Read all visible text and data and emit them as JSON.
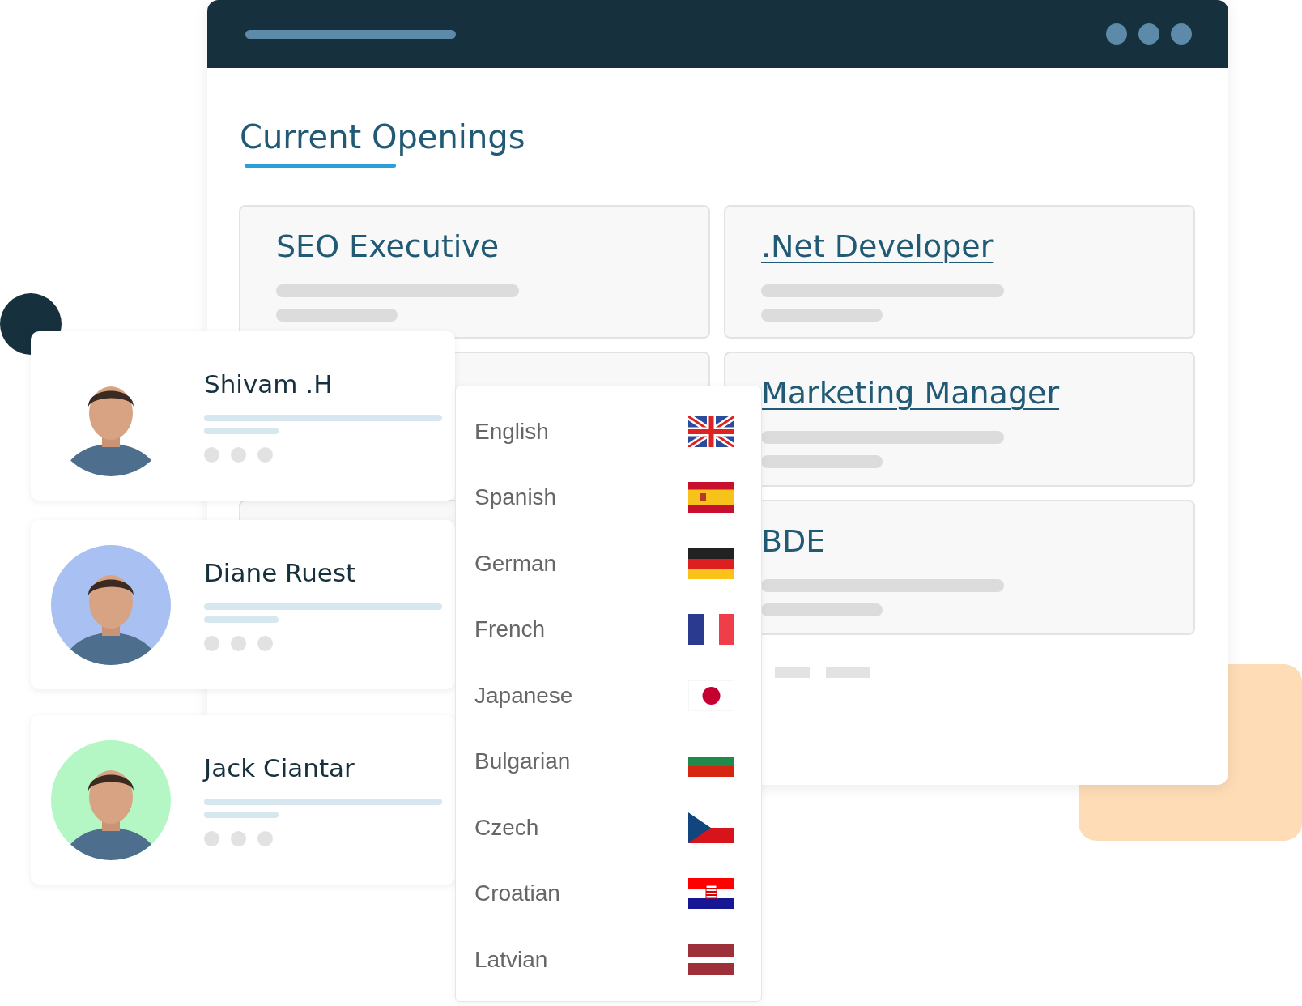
{
  "title": "Current Openings",
  "jobs": [
    {
      "title": "SEO Executive",
      "underlined": false
    },
    {
      "title": ".Net Developer",
      "underlined": true
    },
    {
      "title": "Marketing Manager",
      "underlined": true
    },
    {
      "title": "BDE",
      "underlined": false
    }
  ],
  "candidates": [
    {
      "name": "Shivam .H"
    },
    {
      "name": "Diane Ruest",
      "color": "#a9c0f2"
    },
    {
      "name": "Jack Ciantar",
      "color": "#b5f7c4"
    }
  ],
  "languages": [
    "English",
    "Spanish",
    "German",
    "French",
    "Japanese",
    "Bulgarian",
    "Czech",
    "Croatian",
    "Latvian"
  ]
}
